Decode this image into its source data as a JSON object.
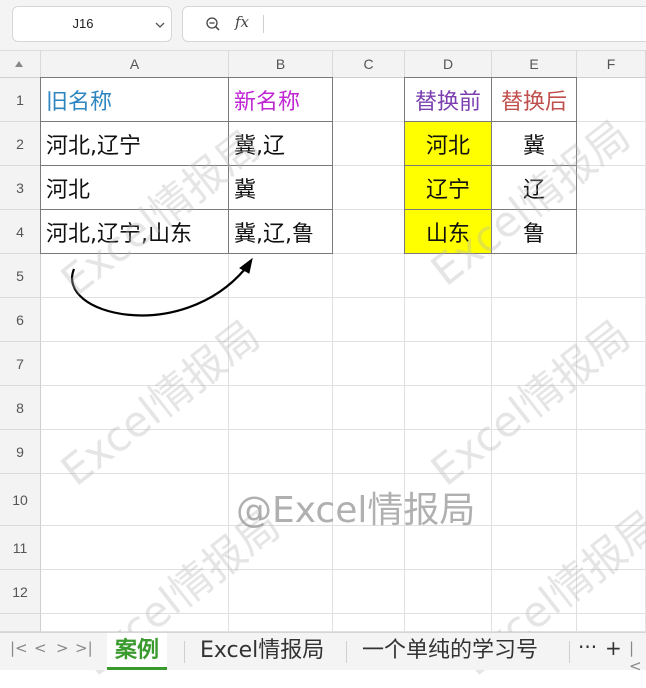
{
  "namebox": {
    "value": "J16"
  },
  "formula_bar": {
    "fx_label": "fx",
    "value": ""
  },
  "columns": [
    "A",
    "B",
    "C",
    "D",
    "E",
    "F"
  ],
  "rows": [
    "1",
    "2",
    "3",
    "4",
    "5",
    "6",
    "7",
    "8",
    "9",
    "10",
    "11",
    "12"
  ],
  "cells": {
    "A1": "旧名称",
    "B1": "新名称",
    "D1": "替换前",
    "E1": "替换后",
    "A2": "河北,辽宁",
    "B2": "冀,辽",
    "D2": "河北",
    "E2": "冀",
    "A3": "河北",
    "B3": "冀",
    "D3": "辽宁",
    "E3": "辽",
    "A4": "河北,辽宁,山东",
    "B4": "冀,辽,鲁",
    "D4": "山东",
    "E4": "鲁"
  },
  "colors": {
    "A1": "#2e86c1",
    "B1": "#c026d3",
    "D1": "#7b3fb0",
    "E1": "#c0504d",
    "highlight": "#ffff00",
    "active_tab": "#3a9a2e"
  },
  "watermark": "Excel情报局",
  "center_watermark": "@Excel情报局",
  "sheet_tabs": [
    "案例",
    "Excel情报局",
    "一个单纯的学习号"
  ],
  "active_tab": "案例",
  "more_label": "···",
  "add_label": "+"
}
